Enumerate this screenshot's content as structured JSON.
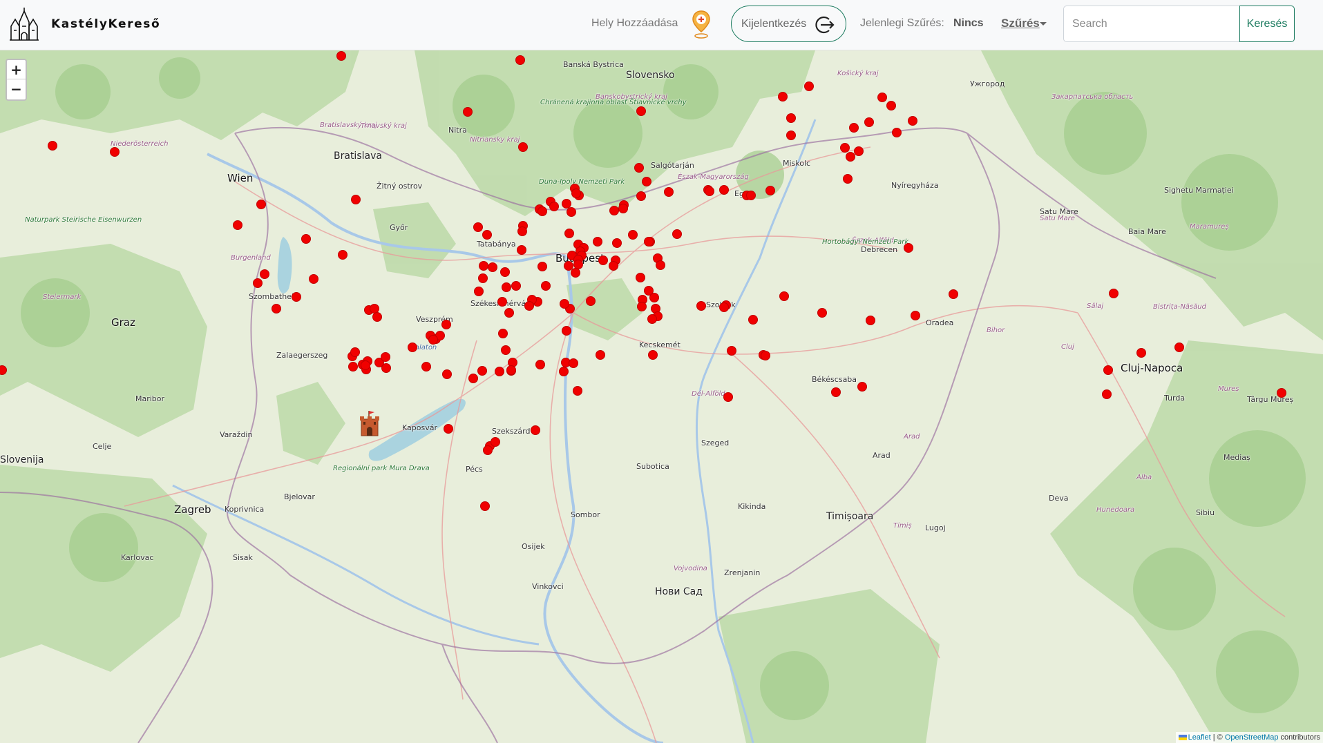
{
  "navbar": {
    "brand": "KastélyKereső",
    "add_place": "Hely Hozzáadása",
    "logout": "Kijelentkezés",
    "filter_current_label": "Jelenlegi Szűrés:",
    "filter_value": "Nincs",
    "filter_dropdown": "Szűrés",
    "search_placeholder": "Search",
    "search_button": "Keresés"
  },
  "map": {
    "zoom_in": "+",
    "zoom_out": "−",
    "attribution_leaflet": "Leaflet",
    "attribution_sep": " | © ",
    "attribution_osm": "OpenStreetMap",
    "attribution_tail": " contributors",
    "marker_color": "#f00000",
    "labels": [
      {
        "text": "Wien",
        "cls": "big"
      },
      {
        "text": "Bratislava",
        "cls": "city"
      },
      {
        "text": "Győr",
        "cls": ""
      },
      {
        "text": "Tatabánya",
        "cls": ""
      },
      {
        "text": "Budapest",
        "cls": "big"
      },
      {
        "text": "Székesfehérvár",
        "cls": ""
      },
      {
        "text": "Veszprém",
        "cls": ""
      },
      {
        "text": "Szombathely",
        "cls": ""
      },
      {
        "text": "Zalaegerszeg",
        "cls": ""
      },
      {
        "text": "Graz",
        "cls": "big"
      },
      {
        "text": "Maribor",
        "cls": ""
      },
      {
        "text": "Kaposvár",
        "cls": ""
      },
      {
        "text": "Pécs",
        "cls": ""
      },
      {
        "text": "Szekszárd",
        "cls": ""
      },
      {
        "text": "Kecskemét",
        "cls": ""
      },
      {
        "text": "Szolnok",
        "cls": ""
      },
      {
        "text": "Szeged",
        "cls": ""
      },
      {
        "text": "Debrecen",
        "cls": ""
      },
      {
        "text": "Miskolc",
        "cls": ""
      },
      {
        "text": "Nyíregyháza",
        "cls": ""
      },
      {
        "text": "Eger",
        "cls": ""
      },
      {
        "text": "Salgótarján",
        "cls": ""
      },
      {
        "text": "Oradea",
        "cls": ""
      },
      {
        "text": "Cluj-Napoca",
        "cls": "big"
      },
      {
        "text": "Arad",
        "cls": ""
      },
      {
        "text": "Timișoara",
        "cls": "city"
      },
      {
        "text": "Békéscsaba",
        "cls": ""
      },
      {
        "text": "Subotica",
        "cls": ""
      },
      {
        "text": "Zagreb",
        "cls": "big"
      },
      {
        "text": "Varaždin",
        "cls": ""
      },
      {
        "text": "Celje",
        "cls": ""
      },
      {
        "text": "Osijek",
        "cls": ""
      },
      {
        "text": "Нови Сад",
        "cls": "city"
      },
      {
        "text": "Sombor",
        "cls": ""
      },
      {
        "text": "Slovensko",
        "cls": "city"
      },
      {
        "text": "Banská Bystrica",
        "cls": ""
      },
      {
        "text": "Nitra",
        "cls": ""
      },
      {
        "text": "Ужгород",
        "cls": ""
      },
      {
        "text": "Satu Mare",
        "cls": ""
      },
      {
        "text": "Baia Mare",
        "cls": ""
      },
      {
        "text": "Sighetu Marmației",
        "cls": ""
      },
      {
        "text": "Turda",
        "cls": ""
      },
      {
        "text": "Târgu Mureș",
        "cls": ""
      },
      {
        "text": "Mediaș",
        "cls": ""
      },
      {
        "text": "Deva",
        "cls": ""
      },
      {
        "text": "Sibiu",
        "cls": ""
      },
      {
        "text": "Lugoj",
        "cls": ""
      },
      {
        "text": "Kikinda",
        "cls": ""
      },
      {
        "text": "Zrenjanin",
        "cls": ""
      },
      {
        "text": "Vinkovci",
        "cls": ""
      },
      {
        "text": "Bjelovar",
        "cls": ""
      },
      {
        "text": "Koprivnica",
        "cls": ""
      },
      {
        "text": "Sisak",
        "cls": ""
      },
      {
        "text": "Karlovac",
        "cls": ""
      },
      {
        "text": "Slovenija",
        "cls": "city"
      },
      {
        "text": "Burgenland",
        "cls": "region"
      },
      {
        "text": "Steiermark",
        "cls": "region"
      },
      {
        "text": "Niederösterreich",
        "cls": "region"
      },
      {
        "text": "Bratislavský kraj",
        "cls": "region"
      },
      {
        "text": "Trnavský kraj",
        "cls": "region"
      },
      {
        "text": "Nitriansky kraj",
        "cls": "region"
      },
      {
        "text": "Banskobystrický kraj",
        "cls": "region"
      },
      {
        "text": "Košický kraj",
        "cls": "region"
      },
      {
        "text": "Закарпатська область",
        "cls": "region"
      },
      {
        "text": "Észak-Magyarország",
        "cls": "region"
      },
      {
        "text": "Észak-Alföld",
        "cls": "region"
      },
      {
        "text": "Dél-Alföld",
        "cls": "region"
      },
      {
        "text": "Sălaj",
        "cls": "region"
      },
      {
        "text": "Bihor",
        "cls": "region"
      },
      {
        "text": "Cluj",
        "cls": "region"
      },
      {
        "text": "Maramureș",
        "cls": "region"
      },
      {
        "text": "Mureș",
        "cls": "region"
      },
      {
        "text": "Alba",
        "cls": "region"
      },
      {
        "text": "Hunedoara",
        "cls": "region"
      },
      {
        "text": "Timiș",
        "cls": "region"
      },
      {
        "text": "Arad",
        "cls": "region"
      },
      {
        "text": "Bistrița-Năsăud",
        "cls": "region"
      },
      {
        "text": "Satu Mare",
        "cls": "region"
      },
      {
        "text": "Vojvodina",
        "cls": "region"
      },
      {
        "text": "Hortobágyi Nemzeti Park",
        "cls": "park"
      },
      {
        "text": "Duna-Ipoly Nemzeti Park",
        "cls": "park"
      },
      {
        "text": "Chránená krajinná oblasť Štiavnické vrchy",
        "cls": "park"
      },
      {
        "text": "Naturpark Steirische Eisenwurzen",
        "cls": "park"
      },
      {
        "text": "Regionální park Mura Drava",
        "cls": "park"
      },
      {
        "text": "Balaton",
        "cls": "water"
      },
      {
        "text": "Žitný ostrov",
        "cls": ""
      }
    ]
  }
}
